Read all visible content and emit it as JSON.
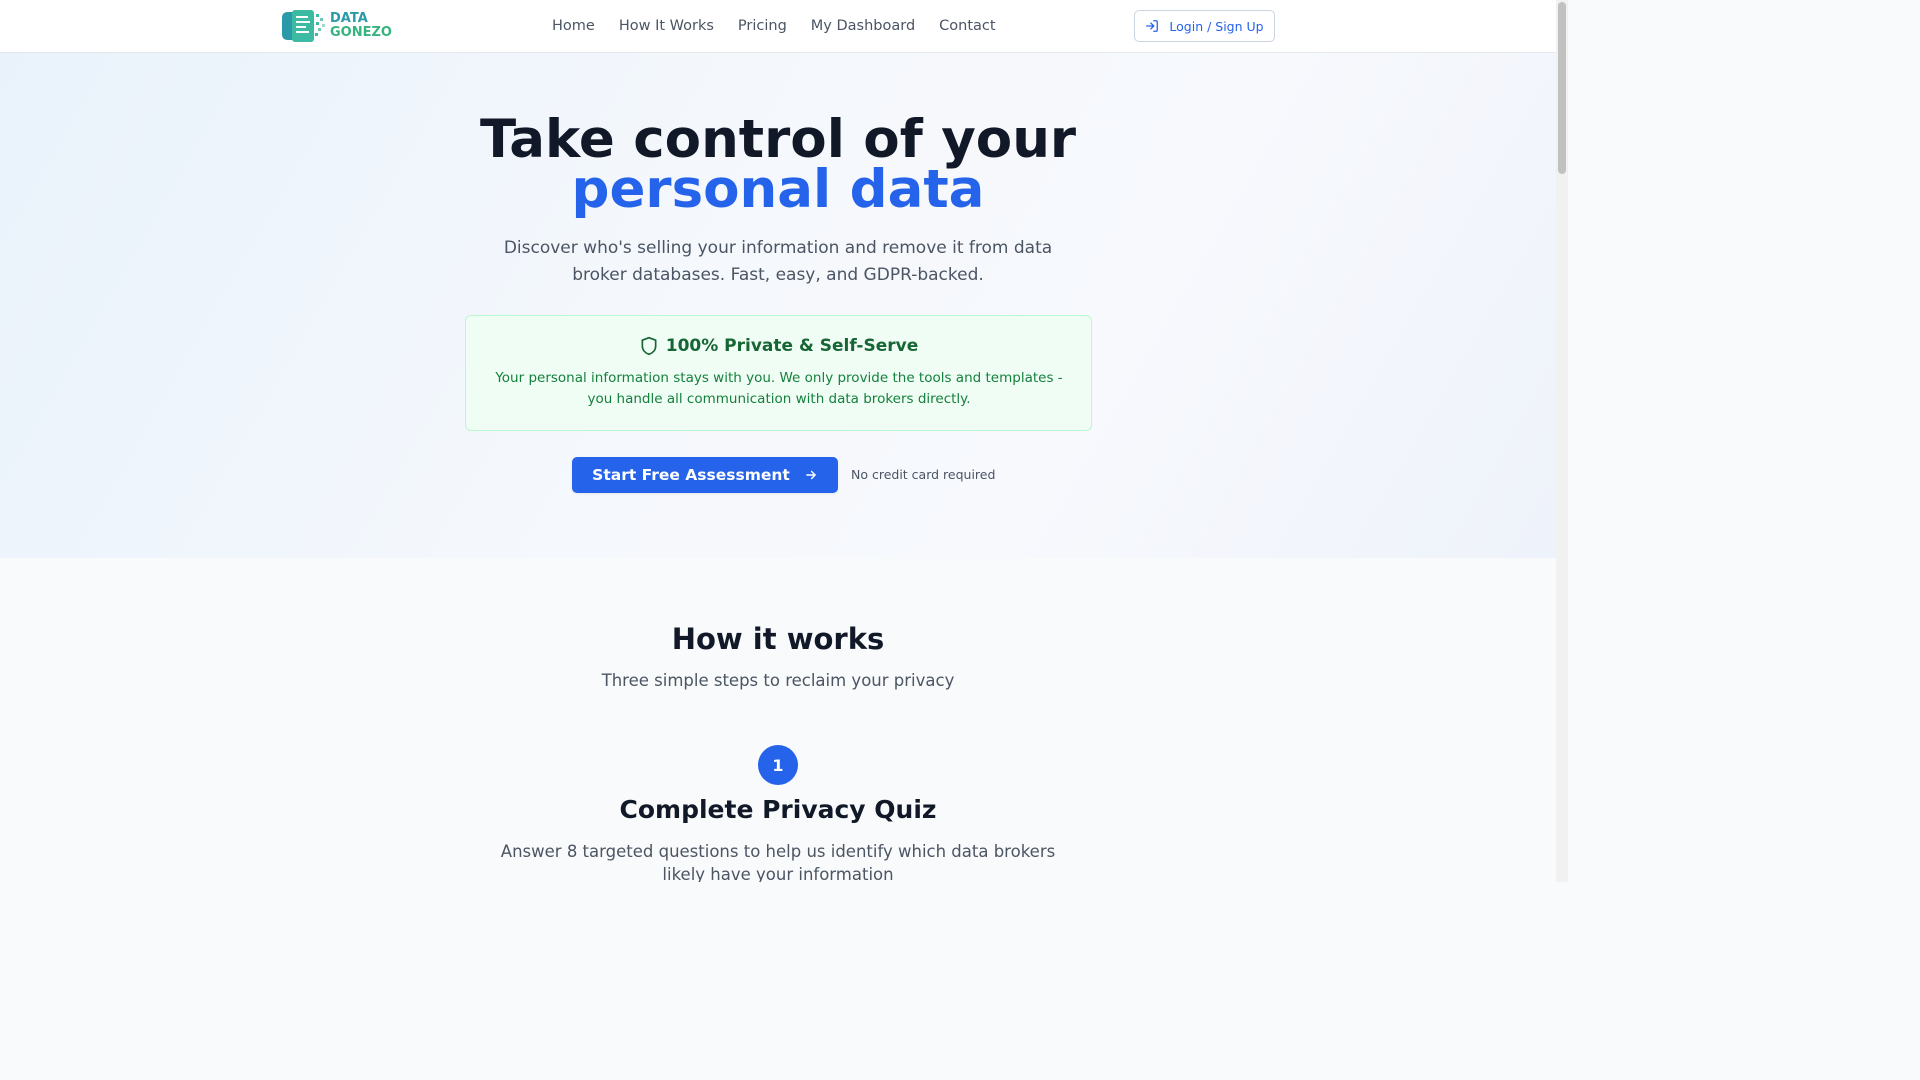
{
  "brand": {
    "line1": "DATA",
    "line2": "GONEZO"
  },
  "nav": {
    "links": [
      "Home",
      "How It Works",
      "Pricing",
      "My Dashboard",
      "Contact"
    ],
    "login_label": "Login / Sign Up"
  },
  "hero": {
    "title_line1": "Take control of your",
    "title_line2": "personal data",
    "subtitle": "Discover who's selling your information and remove it from data broker databases. Fast, easy, and GDPR-backed.",
    "privacy_title": "100% Private & Self-Serve",
    "privacy_text": "Your personal information stays with you. We only provide the tools and templates - you handle all communication with data brokers directly.",
    "cta_label": "Start Free Assessment",
    "cta_note": "No credit card required"
  },
  "how": {
    "title": "How it works",
    "subtitle": "Three simple steps to reclaim your privacy",
    "steps": [
      {
        "number": "1",
        "title": "Complete Privacy Quiz",
        "description": "Answer 8 targeted questions to help us identify which data brokers likely have your information"
      }
    ]
  },
  "colors": {
    "primary": "#2563eb",
    "success": "#166534",
    "success_bg": "#f0fdf4",
    "logo_teal": "#2a9aa8",
    "logo_green": "#36b37e"
  },
  "icons": {
    "login": "login-arrow-icon",
    "shield": "shield-icon",
    "cta_arrow": "arrow-right-icon"
  }
}
